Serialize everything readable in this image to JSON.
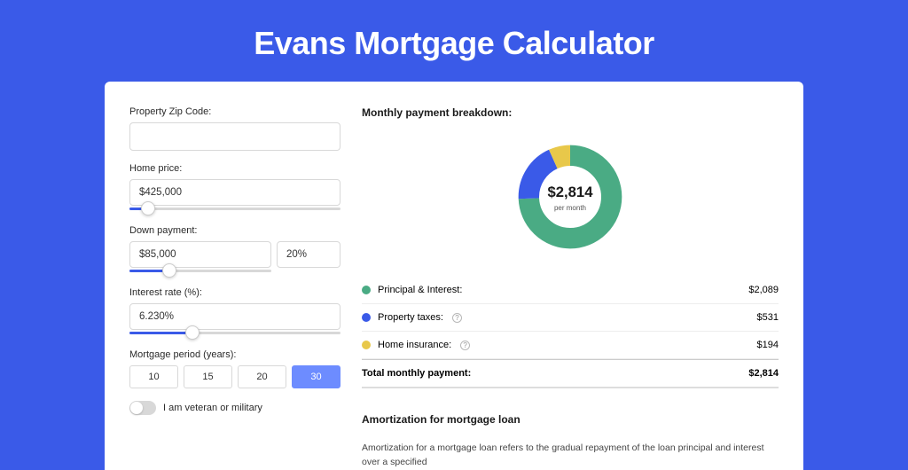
{
  "title": "Evans Mortgage Calculator",
  "form": {
    "zip_label": "Property Zip Code:",
    "zip_value": "",
    "home_price_label": "Home price:",
    "home_price_value": "$425,000",
    "down_payment_label": "Down payment:",
    "down_payment_value": "$85,000",
    "down_payment_pct": "20%",
    "interest_label": "Interest rate (%):",
    "interest_value": "6.230%",
    "period_label": "Mortgage period (years):",
    "periods": [
      "10",
      "15",
      "20",
      "30"
    ],
    "period_selected": "30",
    "veteran_label": "I am veteran or military"
  },
  "breakdown": {
    "title": "Monthly payment breakdown:",
    "center_value": "$2,814",
    "center_sub": "per month",
    "items": [
      {
        "label": "Principal & Interest:",
        "value": "$2,089",
        "color": "#4aab84",
        "info": false
      },
      {
        "label": "Property taxes:",
        "value": "$531",
        "color": "#3a5ae8",
        "info": true
      },
      {
        "label": "Home insurance:",
        "value": "$194",
        "color": "#e8c84a",
        "info": true
      }
    ],
    "total_label": "Total monthly payment:",
    "total_value": "$2,814"
  },
  "amort": {
    "title": "Amortization for mortgage loan",
    "body": "Amortization for a mortgage loan refers to the gradual repayment of the loan principal and interest over a specified"
  },
  "chart_data": {
    "type": "pie",
    "title": "Monthly payment breakdown",
    "slices": [
      {
        "name": "Principal & Interest",
        "value": 2089,
        "color": "#4aab84"
      },
      {
        "name": "Property taxes",
        "value": 531,
        "color": "#3a5ae8"
      },
      {
        "name": "Home insurance",
        "value": 194,
        "color": "#e8c84a"
      }
    ],
    "total": 2814,
    "center_label": "$2,814 per month"
  }
}
